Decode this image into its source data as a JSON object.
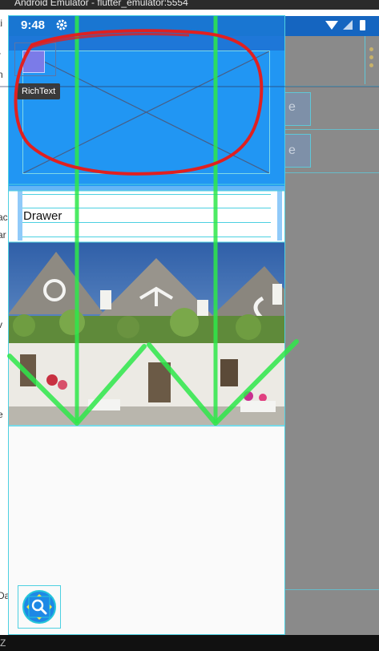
{
  "window": {
    "title": "Android Emulator - flutter_emulator:5554"
  },
  "status_bar": {
    "time": "9:48",
    "icons": [
      "gear-icon",
      "wifi-icon",
      "signal-icon",
      "battery-icon"
    ]
  },
  "hero": {
    "tooltip": "RichText"
  },
  "drawer": {
    "label": "Drawer"
  },
  "fab": {
    "icon": "search-icon"
  },
  "right_panel": {
    "ghost_letters": [
      "e",
      "e"
    ]
  },
  "left_peek": {
    "fragments": [
      "ti",
      "r",
      "n",
      "ac",
      "ar",
      "v",
      "e",
      "Da"
    ]
  },
  "bottom": {
    "fragment": "Z"
  },
  "colors": {
    "app_primary": "#2196f3",
    "status_bar": "#1976d2",
    "debug_outline": "#4dd0e1",
    "annotation_red": "#e02020",
    "annotation_green": "#2ee84a"
  }
}
